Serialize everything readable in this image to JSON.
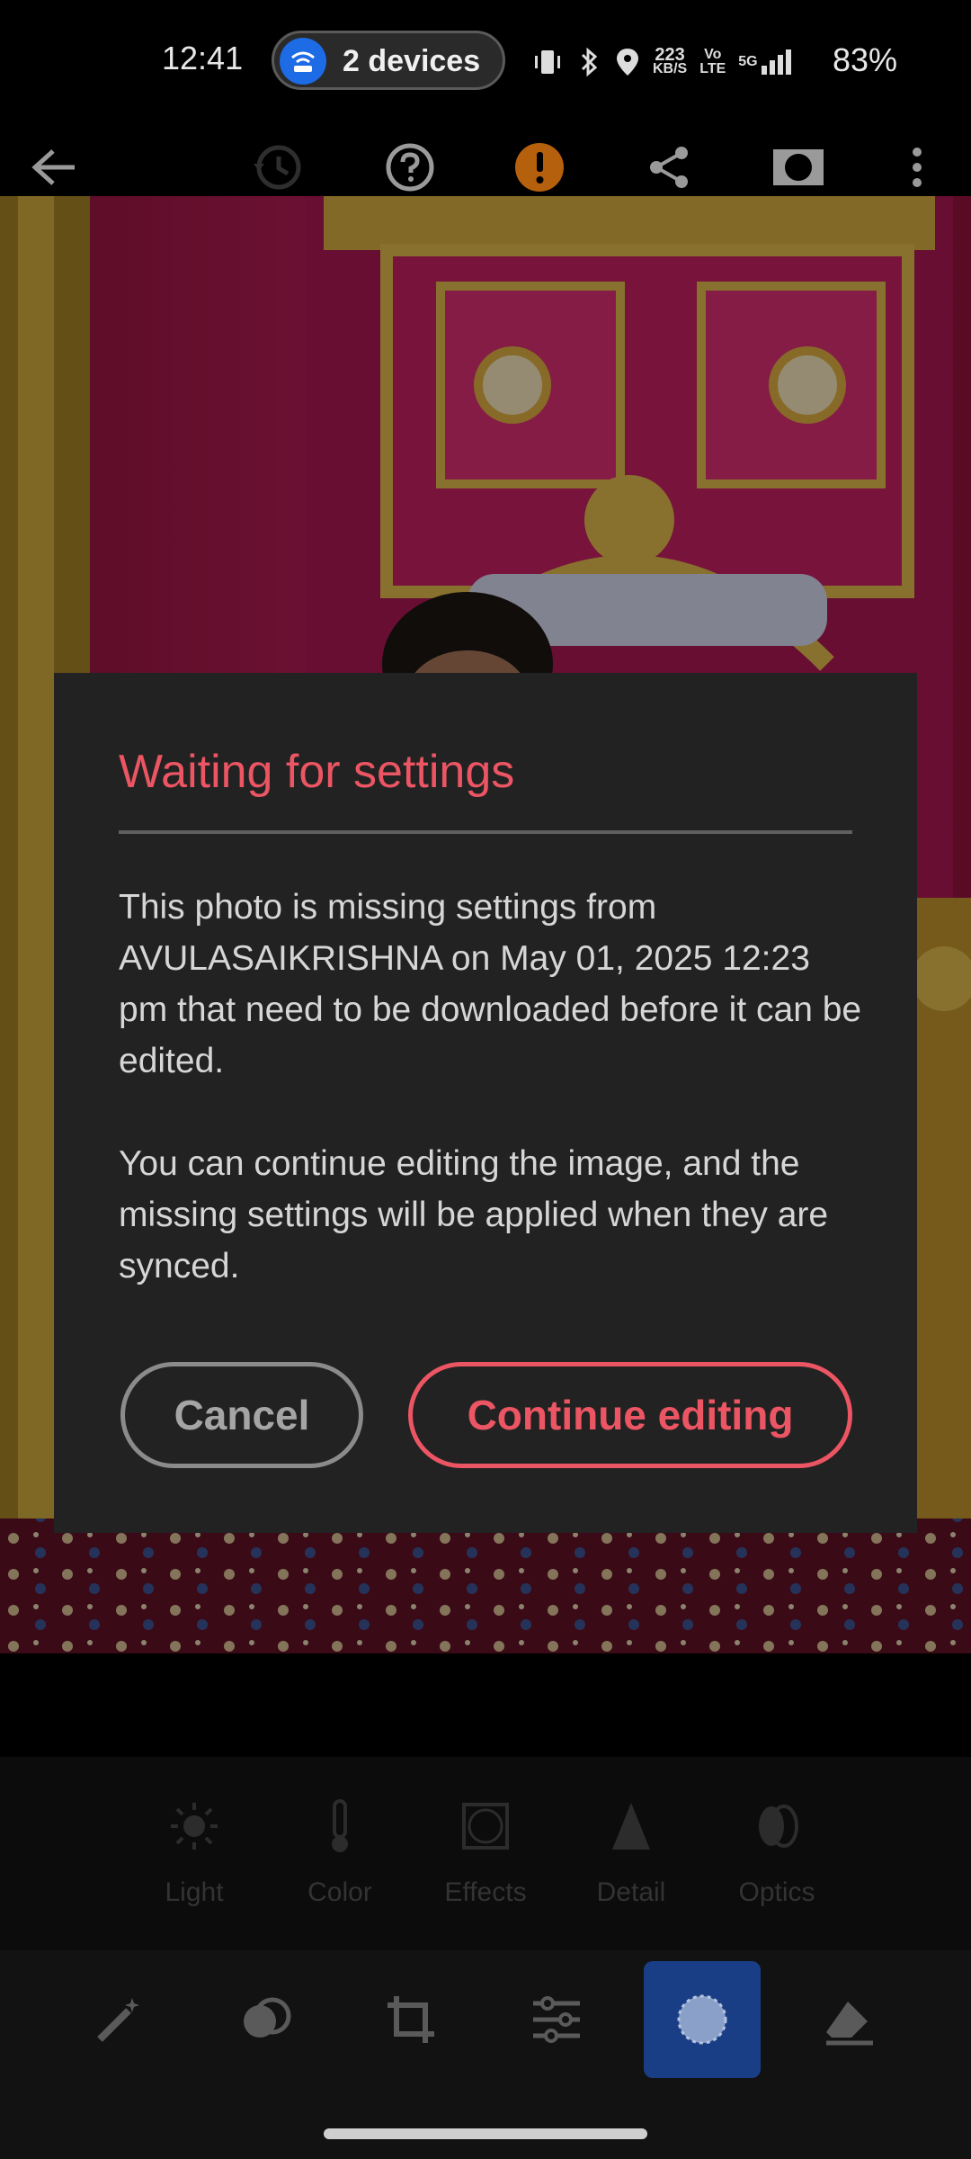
{
  "status_bar": {
    "time": "12:41",
    "hotspot_label": "2 devices",
    "network_speed_value": "223",
    "network_speed_unit": "KB/S",
    "volte_top": "Vo",
    "volte_bottom": "LTE",
    "signal_label": "5G",
    "battery": "83%"
  },
  "toolbar": {
    "icons": [
      "back-arrow-icon",
      "history-icon",
      "help-icon",
      "warning-icon",
      "share-icon",
      "mask-icon",
      "more-vert-icon"
    ]
  },
  "dialog": {
    "title": "Waiting for settings",
    "paragraph1": "This photo is missing settings from AVULASAIKRISHNA on May 01, 2025 12:23 pm that need to be downloaded before it can be edited.",
    "paragraph2": "You can continue editing the image, and the missing settings will be applied when they are synced.",
    "cancel_label": "Cancel",
    "continue_label": "Continue editing",
    "accent_color": "#ec5563"
  },
  "edit_tabs": [
    {
      "label": "Light",
      "icon": "sun-icon"
    },
    {
      "label": "Color",
      "icon": "thermometer-icon"
    },
    {
      "label": "Effects",
      "icon": "vignette-icon"
    },
    {
      "label": "Detail",
      "icon": "triangle-icon"
    },
    {
      "label": "Optics",
      "icon": "lens-icon"
    }
  ],
  "bottom_tools": [
    "magic-wand-icon",
    "presets-icon",
    "crop-icon",
    "adjust-sliders-icon",
    "masking-icon",
    "eraser-icon"
  ]
}
